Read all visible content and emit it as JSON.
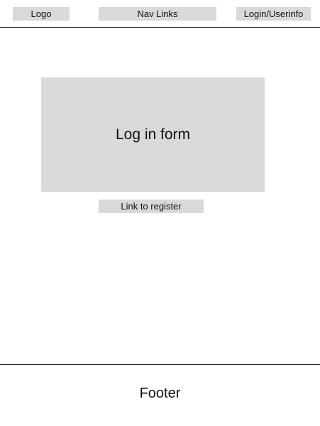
{
  "header": {
    "logo_label": "Logo",
    "nav_label": "Nav Links",
    "login_label": "Login/Userinfo"
  },
  "main": {
    "form_label": "Log in form",
    "register_link": "Link to register"
  },
  "footer": {
    "label": "Footer"
  }
}
